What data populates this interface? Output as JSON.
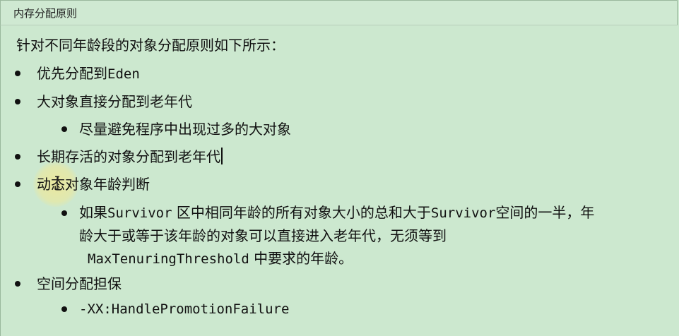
{
  "header": {
    "title": "内存分配原则"
  },
  "intro": "针对不同年龄段的对象分配原则如下所示：",
  "items": [
    {
      "text_cn": "优先分配到",
      "text_en": "Eden"
    },
    {
      "text": "大对象直接分配到老年代"
    },
    {
      "text": "尽量避免程序中出现过多的大对象"
    },
    {
      "text": "长期存活的对象分配到老年代"
    },
    {
      "text": "动态对象年龄判断"
    },
    {
      "line1_a": "如果",
      "line1_b": "Survivor",
      "line1_c": " 区中相同年龄的所有对象大小的总和大于",
      "line1_d": "Survivor",
      "line1_e": "空间的一半，年",
      "line2": "龄大于或等于该年龄的对象可以直接进入老年代，无须等到",
      "line3_code": "MaxTenuringThreshold",
      "line3_rest": " 中要求的年龄。"
    },
    {
      "text": "空间分配担保"
    },
    {
      "code": "-XX:HandlePromotionFailure"
    }
  ]
}
